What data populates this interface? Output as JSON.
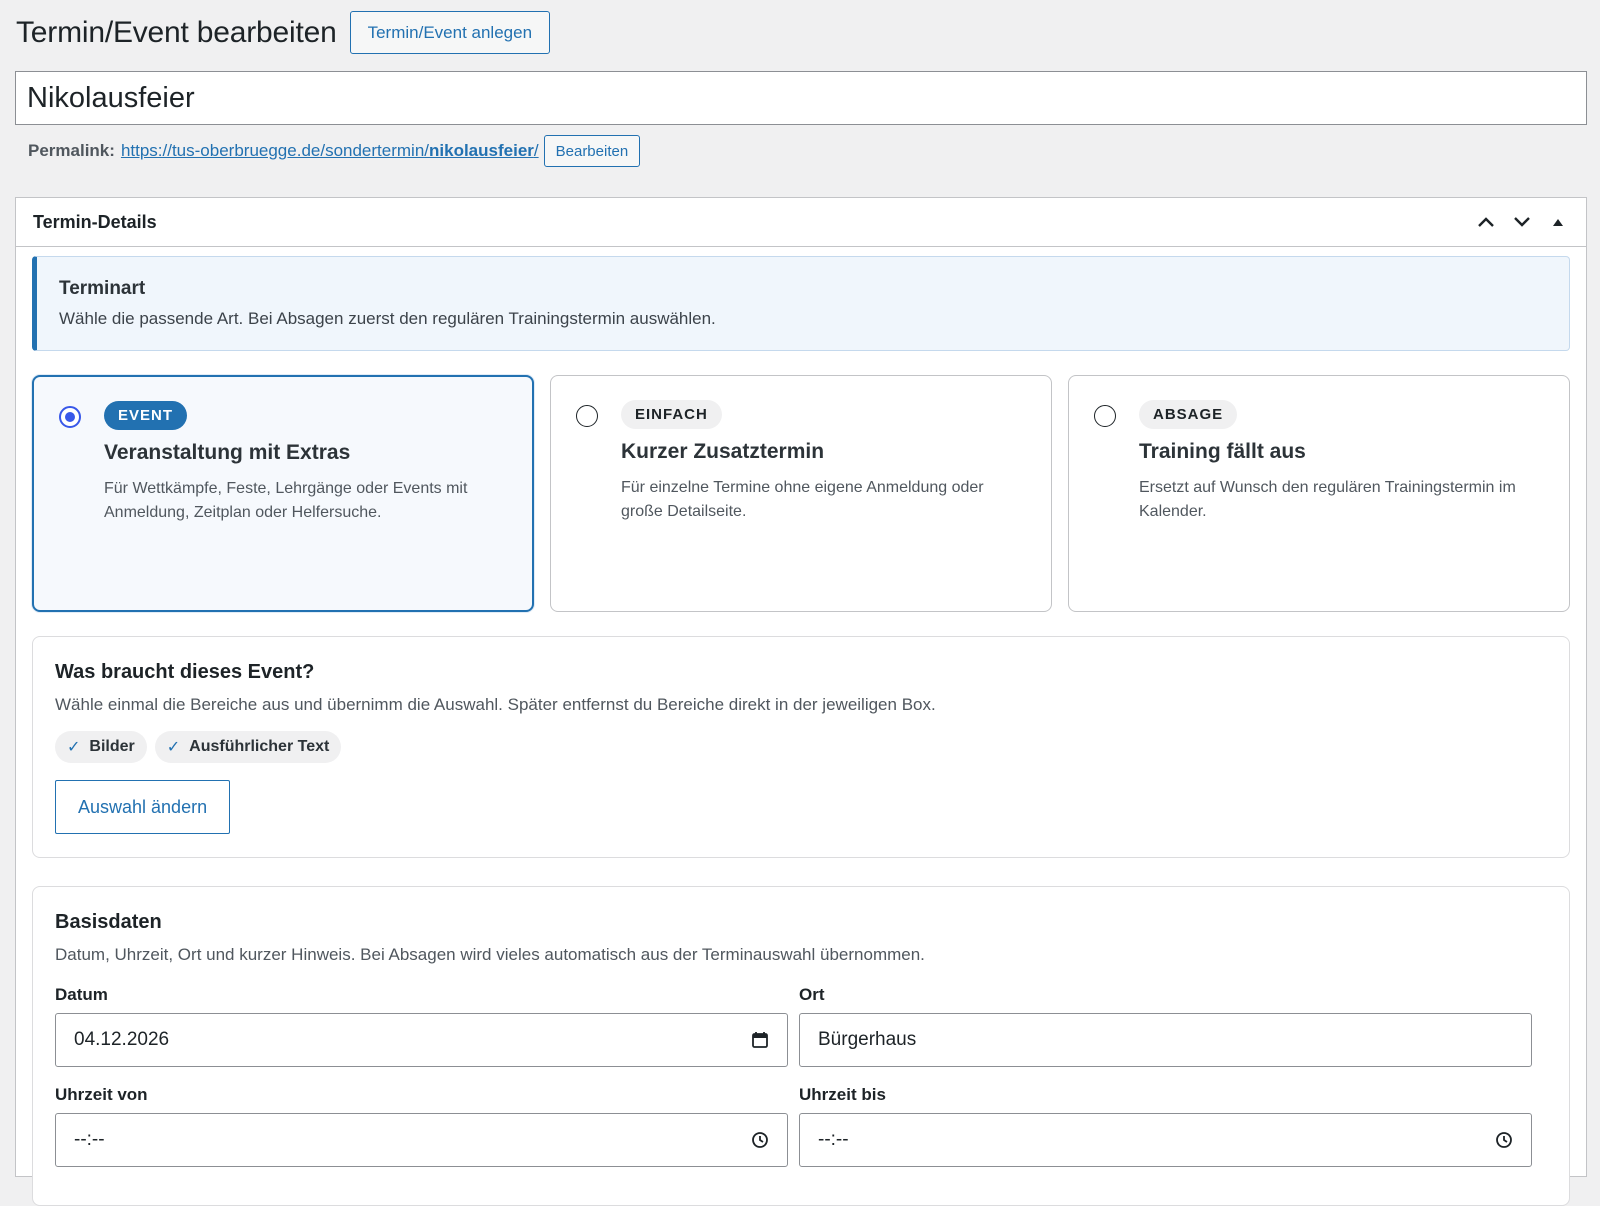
{
  "header": {
    "title": "Termin/Event bearbeiten",
    "add_new_label": "Termin/Event anlegen"
  },
  "post_title": "Nikolausfeier",
  "permalink": {
    "label": "Permalink:",
    "url_base": "https://tus-oberbruegge.de/sondertermin/",
    "slug": "nikolausfeier",
    "url_end": "/",
    "edit_label": "Bearbeiten"
  },
  "metabox": {
    "title": "Termin-Details",
    "icons": [
      "chevron-up-icon",
      "chevron-down-icon",
      "triangle-up-icon"
    ]
  },
  "notice": {
    "title": "Terminart",
    "text": "Wähle die passende Art. Bei Absagen zuerst den regulären Trainingstermin auswählen."
  },
  "types": [
    {
      "badge": "EVENT",
      "title": "Veranstaltung mit Extras",
      "desc": "Für Wettkämpfe, Feste, Lehrgänge oder Events mit Anmeldung, Zeitplan oder Helfersuche.",
      "selected": true
    },
    {
      "badge": "EINFACH",
      "title": "Kurzer Zusatztermin",
      "desc": "Für einzelne Termine ohne eigene Anmeldung oder große Detailseite.",
      "selected": false
    },
    {
      "badge": "ABSAGE",
      "title": "Training fällt aus",
      "desc": "Ersetzt auf Wunsch den regulären Trainingstermin im Kalender.",
      "selected": false
    }
  ],
  "needs": {
    "title": "Was braucht dieses Event?",
    "desc": "Wähle einmal die Bereiche aus und übernimm die Auswahl. Später entfernst du Bereiche direkt in der jeweiligen Box.",
    "chips": [
      "Bilder",
      "Ausführlicher Text"
    ],
    "check_glyph": "✓",
    "change_label": "Auswahl ändern"
  },
  "basis": {
    "title": "Basisdaten",
    "desc": "Datum, Uhrzeit, Ort und kurzer Hinweis. Bei Absagen wird vieles automatisch aus der Terminauswahl übernommen.",
    "date_label": "Datum",
    "date_value": "04.12.2026",
    "place_label": "Ort",
    "place_value": "Bürgerhaus",
    "time_from_label": "Uhrzeit von",
    "time_from_value": "--:--",
    "time_to_label": "Uhrzeit bis",
    "time_to_value": "--:--"
  },
  "colors": {
    "accent": "#2271b1",
    "radio_selected": "#3858e9",
    "background": "#f0f0f1"
  }
}
